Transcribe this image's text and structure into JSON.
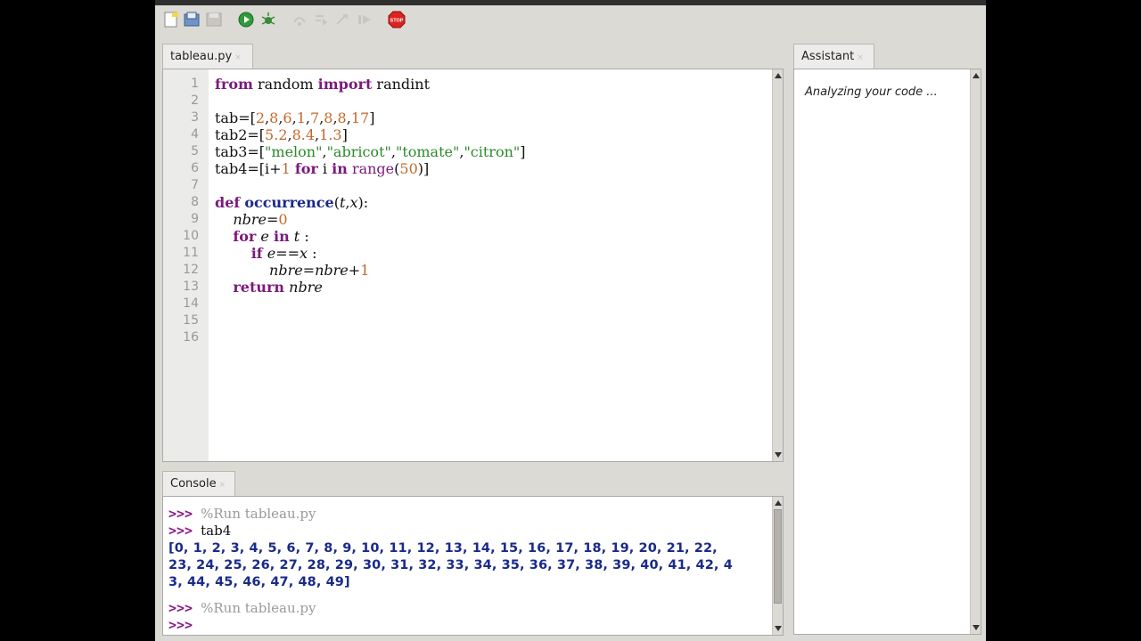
{
  "toolbar": {
    "icons": [
      "new-file-icon",
      "open-icon",
      "save-icon",
      "run-icon",
      "debug-icon",
      "step-over-icon",
      "step-into-icon",
      "step-out-icon",
      "resume-icon",
      "stop-icon"
    ],
    "stop_label": "STOP"
  },
  "editor": {
    "tab_label": "tableau.py",
    "line_numbers": [
      "1",
      "2",
      "3",
      "4",
      "5",
      "6",
      "7",
      "8",
      "9",
      "10",
      "11",
      "12",
      "13",
      "14",
      "15",
      "16"
    ]
  },
  "assistant": {
    "tab_label": "Assistant",
    "message": "Analyzing your code ..."
  },
  "console": {
    "tab_label": "Console",
    "prompt": ">>>",
    "lines": [
      {
        "prompt": ">>>",
        "text": "%Run tableau.py"
      },
      {
        "prompt": ">>>",
        "text": "tab4"
      },
      {
        "prompt": "",
        "text": "[0, 1, 2, 3, 4, 5, 6, 7, 8, 9, 10, 11, 12, 13, 14, 15, 16, 17, 18, 19, 20, 21, 22,"
      },
      {
        "prompt": "",
        "text": "23, 24, 25, 26, 27, 28, 29, 30, 31, 32, 33, 34, 35, 36, 37, 38, 39, 40, 41, 42, 4"
      },
      {
        "prompt": "",
        "text": "3, 44, 45, 46, 47, 48, 49]"
      },
      {
        "prompt": ">>>",
        "text": "%Run tableau.py"
      },
      {
        "prompt": ">>>",
        "text": ""
      }
    ]
  },
  "colors": {
    "keyword": "#7b1a7c",
    "number": "#c2692b",
    "string": "#2a8a2a",
    "function_name": "#1a2a8a",
    "prompt": "#8a1a8a",
    "output": "#1a2a8a"
  }
}
